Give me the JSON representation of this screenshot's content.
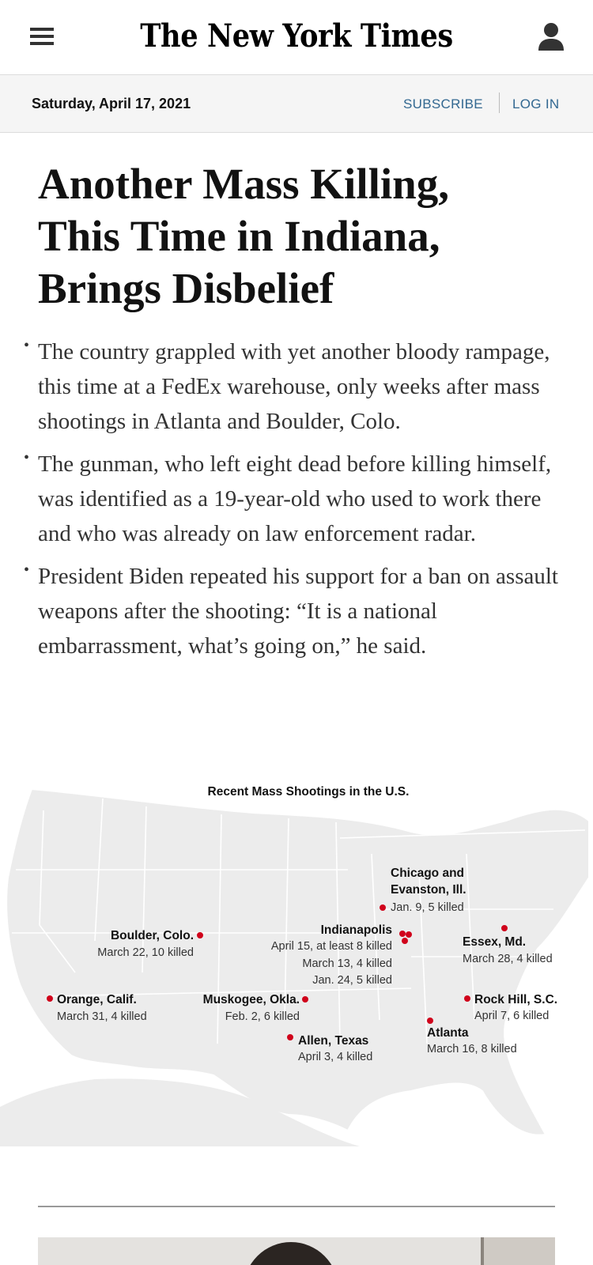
{
  "header": {
    "logo_text": "The New York Times",
    "menu_icon": "hamburger-menu-icon",
    "account_icon": "user-account-icon"
  },
  "datebar": {
    "date": "Saturday, April 17, 2021",
    "subscribe_label": "SUBSCRIBE",
    "login_label": "LOG IN",
    "link_color": "#326891"
  },
  "article": {
    "headline_lines": [
      "Another Mass Killing,",
      "This Time in Indiana,",
      "Brings Disbelief"
    ],
    "bullets": [
      "The country grappled with yet another bloody rampage, this time at a FedEx warehouse, only weeks after mass shootings in Atlanta and Boulder, Colo.",
      "The gunman, who left eight dead before killing himself, was identified as a 19-year-old who used to work there and who was already on law enforcement radar.",
      "President Biden repeated his support for a ban on assault weapons after the shooting: “It is a national embarrassment, what’s going on,” he said."
    ]
  },
  "map": {
    "title": "Recent Mass Shootings in the U.S.",
    "marker_color": "#d0021b",
    "locations": [
      {
        "place": "Chicago and",
        "place2": "Evanston, Ill.",
        "details": [
          "Jan. 9, 5 killed"
        ]
      },
      {
        "place": "Boulder, Colo.",
        "details": [
          "March 22, 10 killed"
        ]
      },
      {
        "place": "Indianapolis",
        "details": [
          "April 15, at least 8 killed",
          "March 13, 4 killed",
          "Jan. 24, 5 killed"
        ]
      },
      {
        "place": "Essex, Md.",
        "details": [
          "March 28, 4 killed"
        ]
      },
      {
        "place": "Orange, Calif.",
        "details": [
          "March 31, 4 killed"
        ]
      },
      {
        "place": "Muskogee, Okla.",
        "details": [
          "Feb. 2, 6 killed"
        ]
      },
      {
        "place": "Rock Hill, S.C.",
        "details": [
          "April 7, 6 killed"
        ]
      },
      {
        "place": "Allen, Texas",
        "details": [
          "April 3, 4 killed"
        ]
      },
      {
        "place": "Atlanta",
        "details": [
          "March 16, 8 killed"
        ]
      }
    ]
  }
}
